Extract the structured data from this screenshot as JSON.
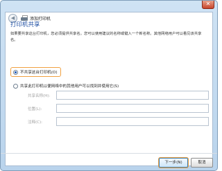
{
  "window": {
    "close_glyph": "✕",
    "back_glyph": "◀",
    "app_title": "添加打印机"
  },
  "page": {
    "title": "打印机共享",
    "intro": "如果要共享这台打印机，您必须提供共享名。您可以使用建议的名称或键入一个新名称。其他网络用户可以看见该共享名。"
  },
  "options": {
    "no_share": "不共享这台打印机(O)",
    "share": "共享此打印机以便网络中的其他用户可以找到并使用它(S)"
  },
  "fields": {
    "share_name_label": "共享名称(H):",
    "share_name_value": "",
    "location_label": "位置(L):",
    "location_value": "",
    "comment_label": "注释(C):",
    "comment_value": ""
  },
  "buttons": {
    "next": "下一步(N)",
    "cancel": "取消"
  },
  "colors": {
    "title_blue": "#1f4fa3",
    "focus_orange": "#f0a040"
  }
}
